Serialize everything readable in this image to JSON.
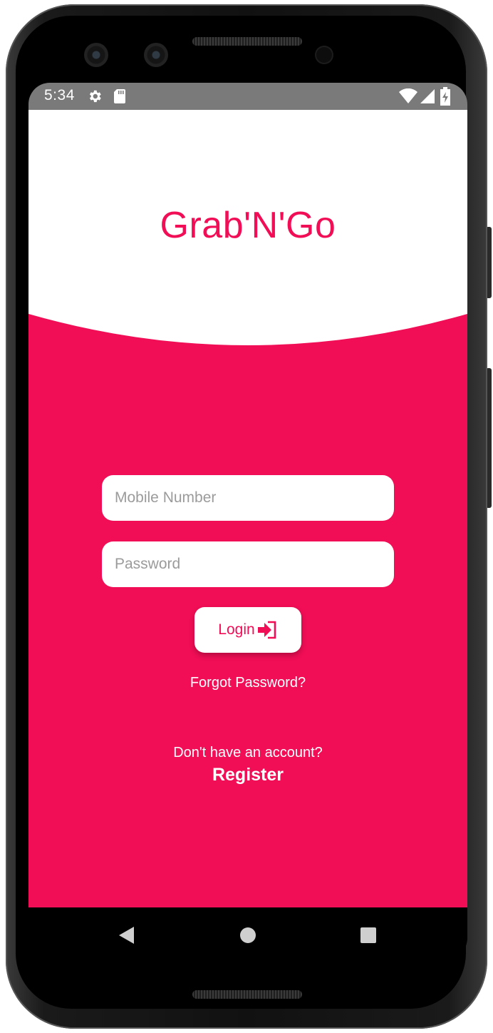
{
  "status_bar": {
    "time": "5:34",
    "icons": [
      "settings-icon",
      "sd-card-icon",
      "wifi-icon",
      "signal-icon",
      "battery-charging-icon"
    ]
  },
  "app": {
    "title": "Grab'N'Go",
    "mobile_placeholder": "Mobile Number",
    "password_placeholder": "Password",
    "login_label": "Login",
    "login_icon": "login-arrow-icon",
    "forgot_password": "Forgot Password?",
    "no_account": "Don't have an account?",
    "register": "Register"
  },
  "nav_bar": {
    "icons": [
      "back-icon",
      "home-icon",
      "recents-icon"
    ]
  },
  "colors": {
    "brand": "#f10e56",
    "status_bar": "#7a7a7a",
    "background": "#ffffff"
  }
}
